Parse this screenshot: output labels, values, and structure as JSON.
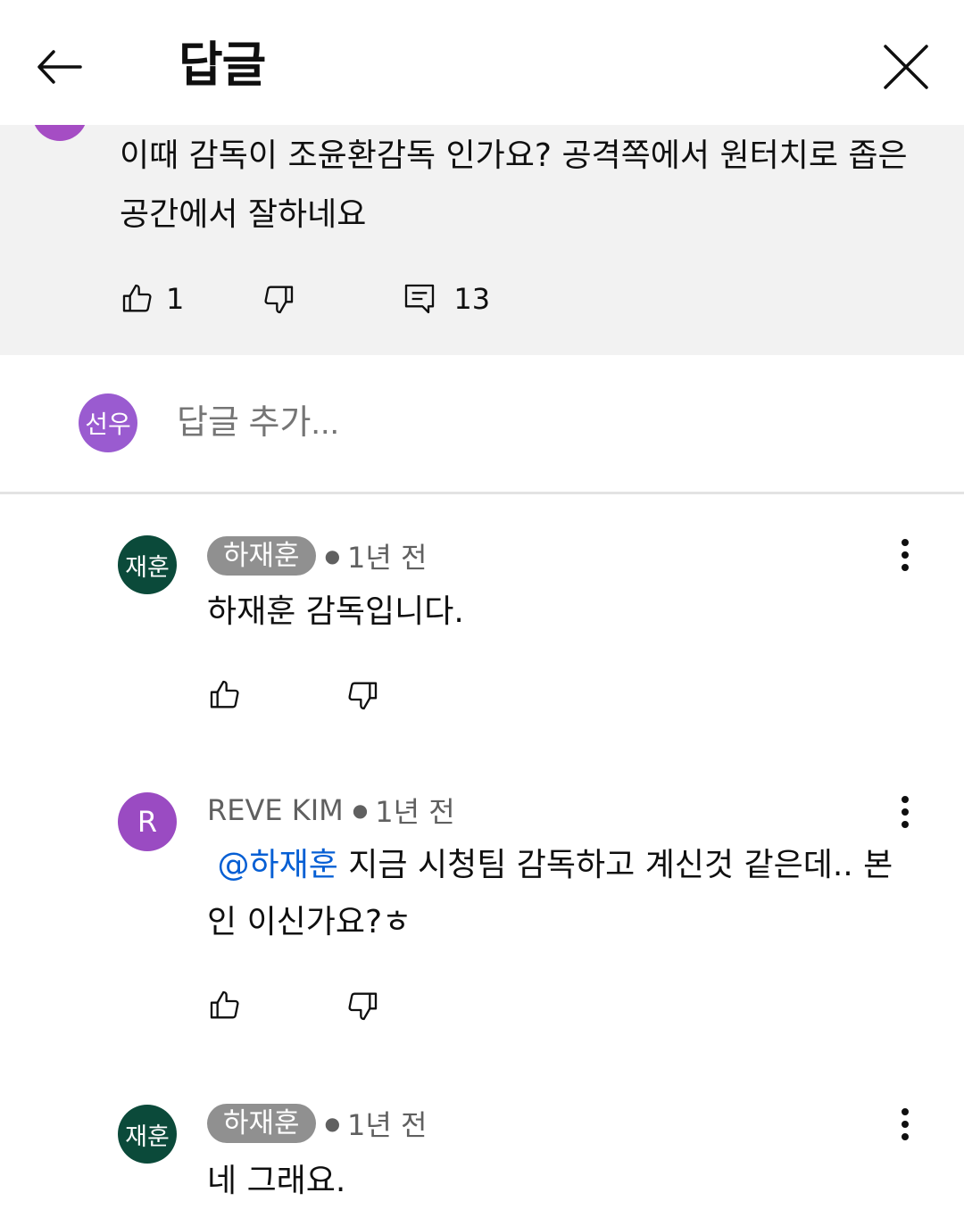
{
  "header": {
    "title": "답글"
  },
  "parent": {
    "text": "이때 감독이 조윤환감독 인가요? 공격쪽에서 원터치로 좁은공간에서 잘하네요",
    "like_count": "1",
    "reply_count": "13"
  },
  "add_reply": {
    "avatar_text": "선우",
    "placeholder": "답글 추가..."
  },
  "replies": [
    {
      "avatar_text": "재훈",
      "avatar_color": "#0b4a3a",
      "author": "하재훈",
      "author_chip": true,
      "time": "1년 전",
      "text": "하재훈 감독입니다."
    },
    {
      "avatar_text": "R",
      "avatar_color": "#9a4bc2",
      "author": "REVE KIM",
      "author_chip": false,
      "time": "1년 전",
      "mention": "@하재훈",
      "text": "지금 시청팀 감독하고 계신것 같은데.. 본인 이신가요?ㅎ"
    },
    {
      "avatar_text": "재훈",
      "avatar_color": "#0b4a3a",
      "author": "하재훈",
      "author_chip": true,
      "time": "1년 전",
      "text": "네 그래요."
    }
  ],
  "colors": {
    "mention": "#065fd4",
    "parent_bg": "#f2f2f2",
    "chip_bg": "#909090"
  }
}
